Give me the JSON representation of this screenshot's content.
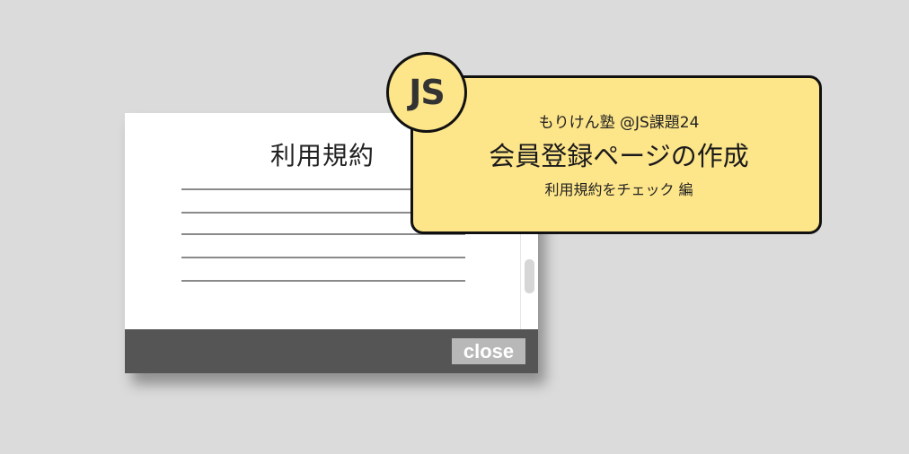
{
  "modal": {
    "title": "利用規約",
    "text_line_count": 5,
    "close_label": "close"
  },
  "card": {
    "subtitle": "もりけん塾 @JS課題24",
    "title": "会員登録ページの作成",
    "caption": "利用規約をチェック 編"
  },
  "badge": {
    "label": "JS"
  },
  "colors": {
    "background": "#dbdbdb",
    "card": "#fde58a",
    "footer": "#555555",
    "close_button": "#b8b8b8"
  }
}
